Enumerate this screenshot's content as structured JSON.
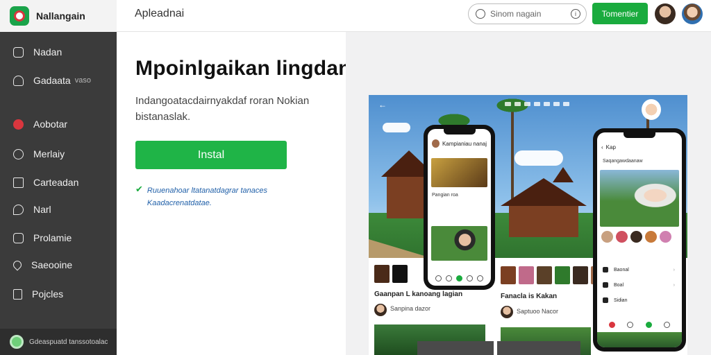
{
  "header": {
    "brand_name": "Nallangain",
    "app_title": "Apleadnai",
    "search_placeholder": "Sinom nagain",
    "action_button": "Tomentier"
  },
  "sidebar": {
    "items": [
      {
        "label": "Nadan",
        "sub": "",
        "icon": "home-icon"
      },
      {
        "label": "Gadaata",
        "sub": "vaso",
        "icon": "user-icon"
      },
      {
        "label": "Aobotar",
        "sub": "",
        "icon": "shield-icon"
      },
      {
        "label": "Merlaiy",
        "sub": "",
        "icon": "clock-icon"
      },
      {
        "label": "Carteadan",
        "sub": "",
        "icon": "calendar-icon"
      },
      {
        "label": "Narl",
        "sub": "",
        "icon": "message-icon"
      },
      {
        "label": "Prolamie",
        "sub": "",
        "icon": "camera-icon"
      },
      {
        "label": "Saeooine",
        "sub": "",
        "icon": "heart-icon"
      },
      {
        "label": "Pojcles",
        "sub": "",
        "icon": "document-icon"
      }
    ],
    "footer_text": "Gdeaspuatd tanssotoalac"
  },
  "main": {
    "title": "Mpoinlgaikan lingdan",
    "description": "Indangoatacdairnyakdaf roran Nokian bistanaslak.",
    "install_button": "Instal",
    "note": "Ruuenahoar ltatanatdagrar tanaces Kaadacrenatdatae."
  },
  "preview": {
    "phone_left": {
      "header": "Kampianiau nanaj",
      "caption": "Pangian roa"
    },
    "phone_right": {
      "header": "Kap",
      "subheader": "Saqangawdaanaw",
      "menu": [
        "Baonal",
        "Boal",
        "Sidian"
      ]
    },
    "feed_left": {
      "title": "Gaanpan L kanoang lagian",
      "meta": "Sanpina dazor"
    },
    "feed_right": {
      "title": "Fanacla is Kakan",
      "meta": "Saptuoo Nacor"
    }
  },
  "colors": {
    "accent": "#1aab3e",
    "sidebar_bg": "#3b3b3b",
    "link": "#1f5fa8"
  }
}
